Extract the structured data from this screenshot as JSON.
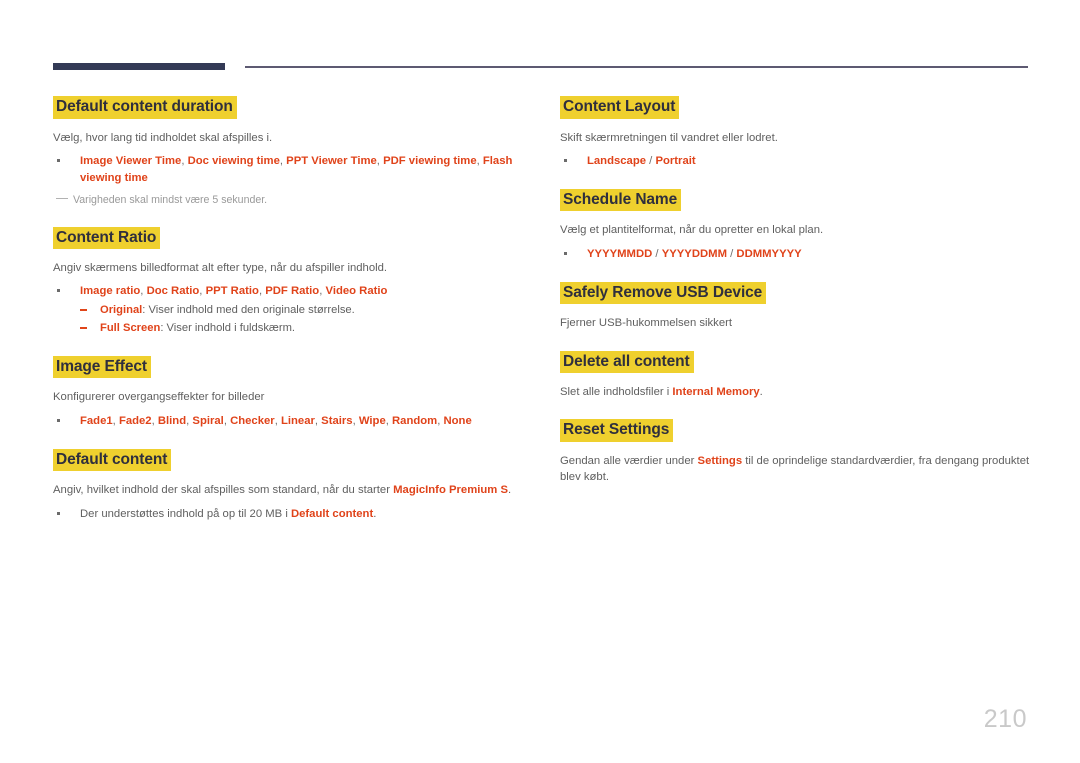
{
  "page": {
    "number": "210",
    "accent_dark": "#333a56",
    "accent_rule": "#5d5a72",
    "highlight_yellow": "#efd02e",
    "emphasis_red": "#e0431a",
    "body_gray": "#5f5f5f"
  },
  "left_column": {
    "sections": [
      {
        "heading": "Default content duration",
        "body": "Vælg, hvor lang tid indholdet skal afspilles i.",
        "bullets": [
          {
            "parts": [
              {
                "text": "Image Viewer Time",
                "style": "red"
              },
              {
                "text": ", ",
                "style": "sep"
              },
              {
                "text": "Doc viewing time",
                "style": "red"
              },
              {
                "text": ", ",
                "style": "sep"
              },
              {
                "text": "PPT Viewer Time",
                "style": "red"
              },
              {
                "text": ", ",
                "style": "sep"
              },
              {
                "text": "PDF viewing time",
                "style": "red"
              },
              {
                "text": ", ",
                "style": "sep"
              },
              {
                "text": "Flash viewing time",
                "style": "red"
              }
            ]
          }
        ],
        "note": "Varigheden skal mindst være 5 sekunder."
      },
      {
        "heading": "Content Ratio",
        "body": "Angiv skærmens billedformat alt efter type, når du afspiller indhold.",
        "bullets": [
          {
            "parts": [
              {
                "text": "Image ratio",
                "style": "red"
              },
              {
                "text": ", ",
                "style": "sep"
              },
              {
                "text": "Doc Ratio",
                "style": "red"
              },
              {
                "text": ", ",
                "style": "sep"
              },
              {
                "text": "PPT Ratio",
                "style": "red"
              },
              {
                "text": ", ",
                "style": "sep"
              },
              {
                "text": "PDF Ratio",
                "style": "red"
              },
              {
                "text": ", ",
                "style": "sep"
              },
              {
                "text": "Video Ratio",
                "style": "red"
              }
            ],
            "sub": [
              {
                "parts": [
                  {
                    "text": "Original",
                    "style": "red"
                  },
                  {
                    "text": ": Viser indhold med den originale størrelse.",
                    "style": "plain"
                  }
                ]
              },
              {
                "parts": [
                  {
                    "text": "Full Screen",
                    "style": "red"
                  },
                  {
                    "text": ": Viser indhold i fuldskærm.",
                    "style": "plain"
                  }
                ]
              }
            ]
          }
        ]
      },
      {
        "heading": "Image Effect",
        "body": "Konfigurerer overgangseffekter for billeder",
        "bullets": [
          {
            "parts": [
              {
                "text": "Fade1",
                "style": "red"
              },
              {
                "text": ", ",
                "style": "sep"
              },
              {
                "text": "Fade2",
                "style": "red"
              },
              {
                "text": ", ",
                "style": "sep"
              },
              {
                "text": "Blind",
                "style": "red"
              },
              {
                "text": ", ",
                "style": "sep"
              },
              {
                "text": "Spiral",
                "style": "red"
              },
              {
                "text": ", ",
                "style": "sep"
              },
              {
                "text": "Checker",
                "style": "red"
              },
              {
                "text": ", ",
                "style": "sep"
              },
              {
                "text": "Linear",
                "style": "red"
              },
              {
                "text": ", ",
                "style": "sep"
              },
              {
                "text": "Stairs",
                "style": "red"
              },
              {
                "text": ", ",
                "style": "sep"
              },
              {
                "text": "Wipe",
                "style": "red"
              },
              {
                "text": ", ",
                "style": "sep"
              },
              {
                "text": "Random",
                "style": "red"
              },
              {
                "text": ", ",
                "style": "sep"
              },
              {
                "text": "None",
                "style": "red"
              }
            ]
          }
        ]
      },
      {
        "heading": "Default content",
        "body_parts": [
          {
            "text": "Angiv, hvilket indhold der skal afspilles som standard, når du starter ",
            "style": "plain"
          },
          {
            "text": "MagicInfo Premium S",
            "style": "red"
          },
          {
            "text": ".",
            "style": "plain"
          }
        ],
        "bullets": [
          {
            "parts": [
              {
                "text": "Der understøttes indhold på op til 20 MB i ",
                "style": "plain"
              },
              {
                "text": "Default content",
                "style": "red"
              },
              {
                "text": ".",
                "style": "plain"
              }
            ]
          }
        ]
      }
    ]
  },
  "right_column": {
    "sections": [
      {
        "heading": "Content Layout",
        "body": "Skift skærmretningen til vandret eller lodret.",
        "bullets": [
          {
            "parts": [
              {
                "text": "Landscape",
                "style": "red"
              },
              {
                "text": " / ",
                "style": "sep"
              },
              {
                "text": "Portrait",
                "style": "red"
              }
            ]
          }
        ]
      },
      {
        "heading": "Schedule Name",
        "body": "Vælg et plantitelformat, når du opretter en lokal plan.",
        "bullets": [
          {
            "parts": [
              {
                "text": "YYYYMMDD",
                "style": "red"
              },
              {
                "text": " / ",
                "style": "sep"
              },
              {
                "text": "YYYYDDMM",
                "style": "red"
              },
              {
                "text": " / ",
                "style": "sep"
              },
              {
                "text": "DDMMYYYY",
                "style": "red"
              }
            ]
          }
        ]
      },
      {
        "heading": "Safely Remove USB Device",
        "body": "Fjerner USB-hukommelsen sikkert",
        "bullets": []
      },
      {
        "heading": "Delete all content",
        "body_parts": [
          {
            "text": "Slet alle indholdsfiler i ",
            "style": "plain"
          },
          {
            "text": "Internal Memory",
            "style": "red"
          },
          {
            "text": ".",
            "style": "plain"
          }
        ],
        "bullets": []
      },
      {
        "heading": "Reset Settings",
        "body_parts": [
          {
            "text": "Gendan alle værdier under ",
            "style": "plain"
          },
          {
            "text": "Settings",
            "style": "red"
          },
          {
            "text": " til de oprindelige standardværdier, fra dengang produktet blev købt.",
            "style": "plain"
          }
        ],
        "bullets": []
      }
    ]
  }
}
